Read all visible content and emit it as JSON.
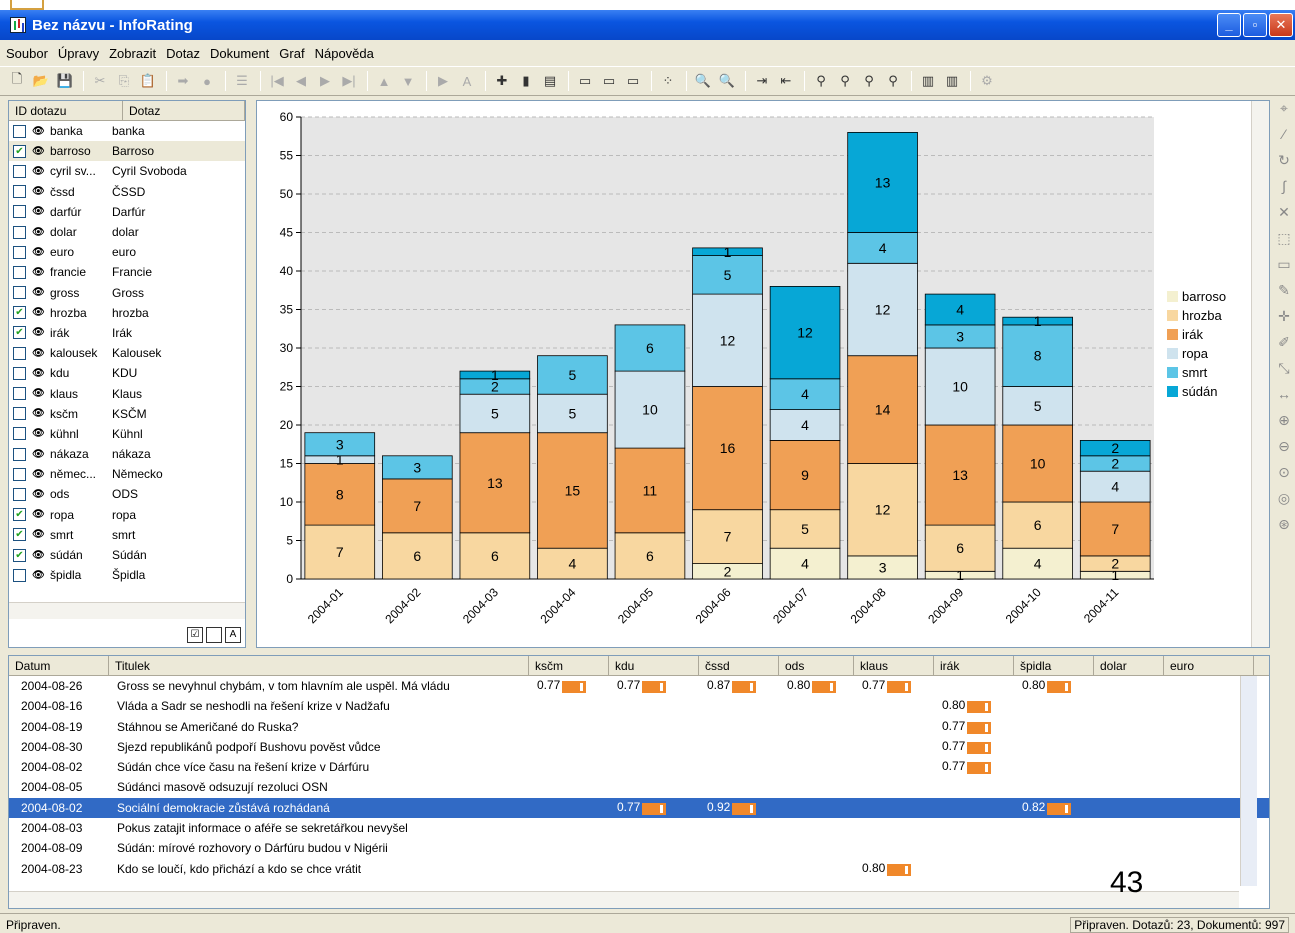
{
  "window": {
    "title": "Bez názvu - InfoRating",
    "buttons": [
      "_",
      "▫",
      "✕"
    ]
  },
  "menu": [
    "Soubor",
    "Úpravy",
    "Zobrazit",
    "Dotaz",
    "Dokument",
    "Graf",
    "Nápověda"
  ],
  "toolbar_icons": [
    "new-icon",
    "open-icon",
    "save-icon",
    "cut-icon",
    "copy-icon",
    "paste-icon",
    "send-icon",
    "record-icon",
    "list-icon",
    "first-icon",
    "prev-icon",
    "next-icon",
    "last-icon",
    "up-icon",
    "down-icon",
    "play-icon",
    "font-icon",
    "target-icon",
    "bar-chart-icon",
    "report-icon",
    "layout1-icon",
    "layout2-icon",
    "layout3-icon",
    "scatter-icon",
    "zoom-a-icon",
    "zoom-b-icon",
    "export-icon",
    "import-icon",
    "search1-icon",
    "search7-icon",
    "search30-icon",
    "search356-icon",
    "bars1-icon",
    "bars2-icon",
    "settings-icon"
  ],
  "queries": {
    "headers": [
      "ID dotazu",
      "Dotaz"
    ],
    "rows": [
      {
        "id": "banka",
        "name": "banka",
        "checked": false
      },
      {
        "id": "barroso",
        "name": "Barroso",
        "checked": true
      },
      {
        "id": "cyril sv...",
        "name": "Cyril Svoboda",
        "checked": false
      },
      {
        "id": "čssd",
        "name": "ČSSD",
        "checked": false
      },
      {
        "id": "darfúr",
        "name": "Darfúr",
        "checked": false
      },
      {
        "id": "dolar",
        "name": "dolar",
        "checked": false
      },
      {
        "id": "euro",
        "name": "euro",
        "checked": false
      },
      {
        "id": "francie",
        "name": "Francie",
        "checked": false
      },
      {
        "id": "gross",
        "name": "Gross",
        "checked": false
      },
      {
        "id": "hrozba",
        "name": "hrozba",
        "checked": true
      },
      {
        "id": "irák",
        "name": "Irák",
        "checked": true
      },
      {
        "id": "kalousek",
        "name": "Kalousek",
        "checked": false
      },
      {
        "id": "kdu",
        "name": "KDU",
        "checked": false
      },
      {
        "id": "klaus",
        "name": "Klaus",
        "checked": false
      },
      {
        "id": "ksčm",
        "name": "KSČM",
        "checked": false
      },
      {
        "id": "kühnl",
        "name": "Kühnl",
        "checked": false
      },
      {
        "id": "nákaza",
        "name": "nákaza",
        "checked": false
      },
      {
        "id": "němec...",
        "name": "Německo",
        "checked": false
      },
      {
        "id": "ods",
        "name": "ODS",
        "checked": false
      },
      {
        "id": "ropa",
        "name": "ropa",
        "checked": true
      },
      {
        "id": "smrt",
        "name": "smrt",
        "checked": true
      },
      {
        "id": "súdán",
        "name": "Súdán",
        "checked": true
      },
      {
        "id": "špidla",
        "name": "Špidla",
        "checked": false
      }
    ]
  },
  "chart_data": {
    "type": "bar",
    "stacked": true,
    "categories": [
      "2004-01",
      "2004-02",
      "2004-03",
      "2004-04",
      "2004-05",
      "2004-06",
      "2004-07",
      "2004-08",
      "2004-09",
      "2004-10",
      "2004-11"
    ],
    "ylim": [
      0,
      60
    ],
    "yticks": [
      0,
      5,
      10,
      15,
      20,
      25,
      30,
      35,
      40,
      45,
      50,
      55,
      60
    ],
    "legend_position": "right",
    "series": [
      {
        "name": "barroso",
        "color": "#f4f0d0",
        "values": [
          0,
          0,
          0,
          0,
          0,
          2,
          4,
          3,
          1,
          4,
          1
        ]
      },
      {
        "name": "hrozba",
        "color": "#f8d7a0",
        "values": [
          7,
          6,
          6,
          4,
          6,
          7,
          5,
          12,
          6,
          6,
          2
        ]
      },
      {
        "name": "irák",
        "color": "#f0a055",
        "values": [
          8,
          7,
          13,
          15,
          11,
          16,
          9,
          14,
          13,
          10,
          7
        ]
      },
      {
        "name": "ropa",
        "color": "#cfe3ee",
        "values": [
          1,
          0,
          5,
          5,
          10,
          12,
          4,
          12,
          10,
          5,
          4
        ]
      },
      {
        "name": "smrt",
        "color": "#5cc5e6",
        "values": [
          3,
          3,
          2,
          5,
          6,
          5,
          4,
          4,
          3,
          8,
          2
        ]
      },
      {
        "name": "súdán",
        "color": "#07a7d6",
        "values": [
          0,
          0,
          1,
          0,
          0,
          1,
          12,
          13,
          4,
          1,
          2
        ]
      }
    ],
    "grid": true
  },
  "documents": {
    "headers": [
      "Datum",
      "Titulek",
      "ksčm",
      "kdu",
      "čssd",
      "ods",
      "klaus",
      "irák",
      "špidla",
      "dolar",
      "euro"
    ],
    "rows": [
      {
        "date": "2004-08-26",
        "title": "Gross se nevyhnul chybám, v tom hlavním ale uspěl. Má vládu",
        "v": {
          "ksčm": "0.77",
          "kdu": "0.77",
          "čssd": "0.87",
          "ods": "0.80",
          "klaus": "0.77",
          "špidla": "0.80"
        }
      },
      {
        "date": "2004-08-16",
        "title": "Vláda a Sadr se neshodli na řešení krize v Nadžafu",
        "v": {
          "irák": "0.80"
        }
      },
      {
        "date": "2004-08-19",
        "title": "Stáhnou se Američané do Ruska?",
        "v": {
          "irák": "0.77"
        }
      },
      {
        "date": "2004-08-30",
        "title": "Sjezd republikánů podpoří Bushovu pověst vůdce",
        "v": {
          "irák": "0.77"
        }
      },
      {
        "date": "2004-08-02",
        "title": "Súdán chce více času na řešení krize v Dárfúru",
        "v": {
          "irák": "0.77"
        }
      },
      {
        "date": "2004-08-05",
        "title": "Súdánci masově odsuzují rezoluci OSN",
        "v": {}
      },
      {
        "date": "2004-08-02",
        "title": "Sociální demokracie zůstává rozhádaná",
        "v": {
          "kdu": "0.77",
          "čssd": "0.92",
          "špidla": "0.82"
        },
        "selected": true
      },
      {
        "date": "2004-08-03",
        "title": "Pokus zatajit informace o aféře se sekretářkou nevyšel",
        "v": {}
      },
      {
        "date": "2004-08-09",
        "title": "Súdán: mírové rozhovory o Dárfúru budou v Nigérii",
        "v": {}
      },
      {
        "date": "2004-08-23",
        "title": "Kdo se loučí, kdo přichází a kdo se chce vrátit",
        "v": {
          "klaus": "0.80"
        }
      }
    ]
  },
  "slide_number": "43",
  "status": {
    "left": "Připraven.",
    "right": "Připraven. Dotazů: 23, Dokumentů: 997"
  }
}
